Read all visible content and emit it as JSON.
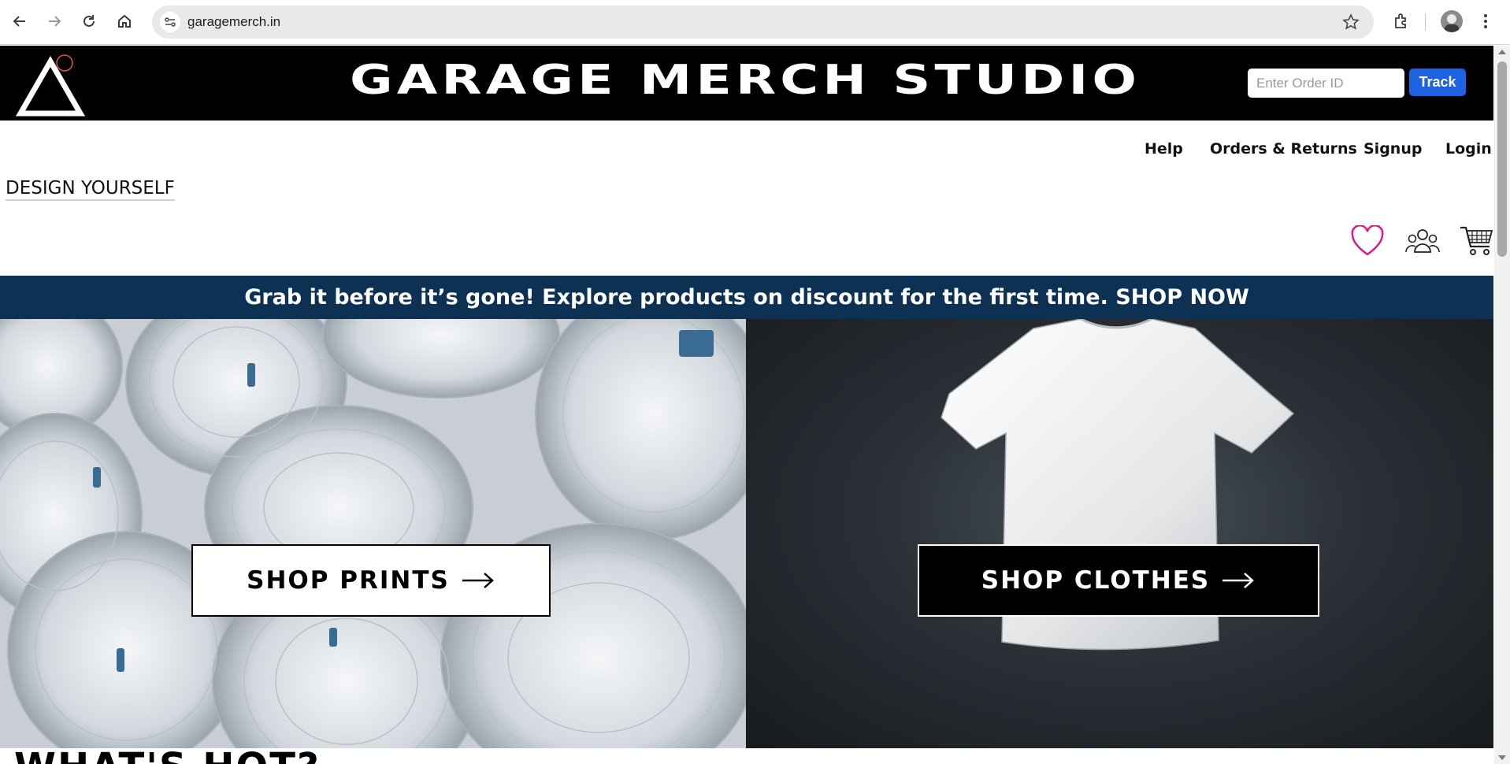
{
  "browser": {
    "url": "garagemerch.in"
  },
  "header": {
    "brand": "GARAGE MERCH STUDIO",
    "order_placeholder": "Enter Order ID",
    "track_label": "Track"
  },
  "menu": {
    "items": [
      {
        "label": "Help"
      },
      {
        "label": "Orders & Returns"
      },
      {
        "label": "Signup"
      },
      {
        "label": "Login"
      }
    ]
  },
  "design_link": "DESIGN YOURSELF",
  "icons": {
    "wishlist": "heart-icon",
    "community": "users-icon",
    "cart": "cart-icon",
    "wishlist_color": "#e0198a"
  },
  "promo": {
    "text": "Grab it before it’s gone! Explore products on discount for the first time. SHOP NOW",
    "background": "#0c3152"
  },
  "hero": {
    "prints_label": "SHOP PRINTS",
    "clothes_label": "SHOP CLOTHES"
  },
  "section_heading": "WHAT'S HOT?"
}
